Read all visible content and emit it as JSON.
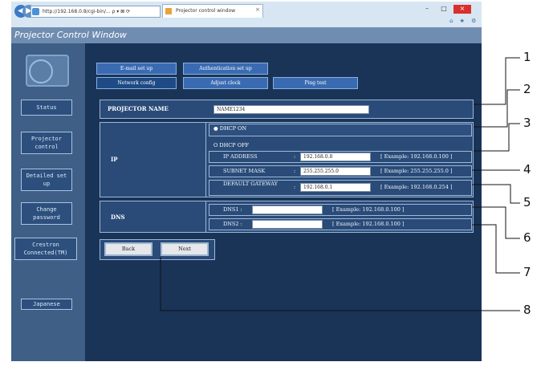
{
  "browser": {
    "back_icon": "back-arrow-icon",
    "forward_icon": "forward-arrow-icon",
    "address_text": "http://192.168.0.8/cgi-bin/...  ρ ▾ ⊠ ⟳",
    "tab_title": "Projector control window",
    "tab_close": "×",
    "min_btn": "–",
    "max_btn": "□",
    "close_btn": "×",
    "toolbar_icons": "⌂ ★ ⚙"
  },
  "app": {
    "title": "Projector Control Window"
  },
  "sidebar": {
    "items": [
      {
        "label": "Status"
      },
      {
        "label": "Projector control"
      },
      {
        "label": "Detailed set up"
      },
      {
        "label": "Change password"
      },
      {
        "label": "Crestron Connected(TM)"
      },
      {
        "label": "Japanese"
      }
    ]
  },
  "tabs": {
    "row1": [
      {
        "label": "E-mail set up"
      },
      {
        "label": "Authentication set up"
      }
    ],
    "row2": [
      {
        "label": "Network config"
      },
      {
        "label": "Adjust clock"
      },
      {
        "label": "Ping test"
      }
    ]
  },
  "form": {
    "projector_name_label": "PROJECTOR NAME",
    "projector_name_value": "NAME1234",
    "ip_label": "IP",
    "dhcp_on": "● DHCP ON",
    "dhcp_off": "O DHCP OFF",
    "ip_address_label": "IP ADDRESS",
    "ip_address_value": "192.168.0.8",
    "ip_address_example": "[ Example: 192.168.0.100 ]",
    "subnet_label": "SUBNET MASK",
    "subnet_value": "255.255.255.0",
    "subnet_example": "[ Example: 255.255.255.0 ]",
    "gateway_label": "DEFAULT GATEWAY",
    "gateway_value": "192.168.0.1",
    "gateway_example": "[ Example: 192.168.0.254 ]",
    "dns_label": "DNS",
    "dns1_label": "DNS1 :",
    "dns1_value": "",
    "dns1_example": "[ Example: 192.168.0.100 ]",
    "dns2_label": "DNS2 :",
    "dns2_value": "",
    "dns2_example": "[ Example: 192.168.0.100 ]",
    "colon": ":"
  },
  "buttons": {
    "back": "Back",
    "next": "Next"
  },
  "callouts": [
    "1",
    "2",
    "3",
    "4",
    "5",
    "6",
    "7",
    "8"
  ]
}
